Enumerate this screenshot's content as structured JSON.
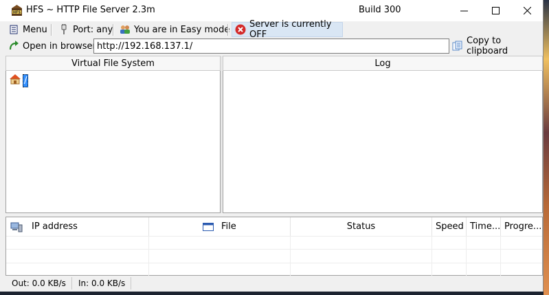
{
  "titlebar": {
    "title": "HFS ~ HTTP File Server 2.3m",
    "build": "Build 300",
    "icon": "hfs-app-icon"
  },
  "toolbar": {
    "menu_label": "Menu",
    "port_label": "Port: any",
    "mode_label": "You are in Easy mode",
    "server_status_label": "Server is currently OFF",
    "open_browser_label": "Open in browser",
    "url_value": "http://192.168.137.1/",
    "copy_label": "Copy to clipboard"
  },
  "panels": {
    "vfs_title": "Virtual File System",
    "log_title": "Log",
    "vfs_root": "/"
  },
  "connections": {
    "columns": [
      "IP address",
      "File",
      "Status",
      "Speed",
      "Time...",
      "Progre..."
    ]
  },
  "statusbar": {
    "out": "Out: 0.0 KB/s",
    "in": "In: 0.0 KB/s"
  },
  "colors": {
    "selection": "#3390ff",
    "status_off_icon": "#d42a2a",
    "status_highlight": "#d9e6f4"
  }
}
